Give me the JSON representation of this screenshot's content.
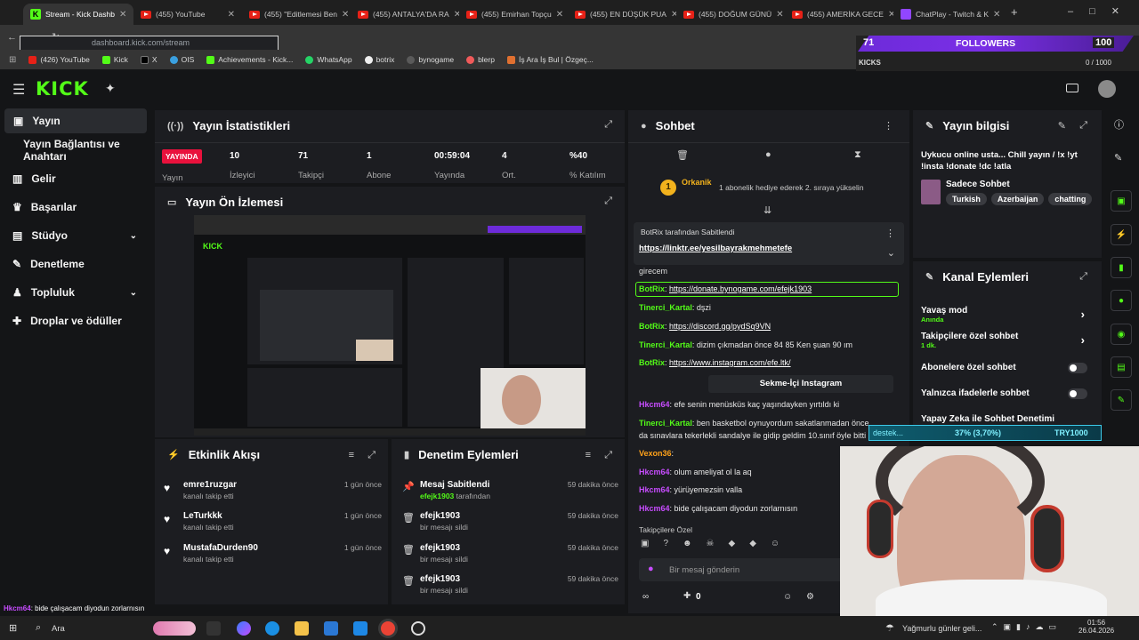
{
  "browser": {
    "tabs": [
      {
        "label": "Stream - Kick Dashb",
        "icon": "kick"
      },
      {
        "label": "(455) YouTube",
        "icon": "youtube"
      },
      {
        "label": "(455) \"Editlemesi Ben",
        "icon": "youtube"
      },
      {
        "label": "(455) ANTALYA'DA RA",
        "icon": "youtube"
      },
      {
        "label": "(455) Emirhan Topçu",
        "icon": "youtube"
      },
      {
        "label": "(455) EN DÜŞÜK PUA",
        "icon": "youtube"
      },
      {
        "label": "(455) DOĞUM GÜNÜ",
        "icon": "youtube"
      },
      {
        "label": "(455) AMERİKA GECE",
        "icon": "youtube"
      },
      {
        "label": "ChatPlay - Twitch & K",
        "icon": "twitch"
      }
    ],
    "url": "dashboard.kick.com/stream",
    "bookmarks": [
      "(426) YouTube",
      "Kick",
      "X",
      "OIS",
      "Achievements - Kick...",
      "WhatsApp",
      "botrix",
      "bynogame",
      "blerp",
      "İş Ara İş Bul | Özgeç..."
    ]
  },
  "overlay": {
    "followers_count": "71",
    "followers_label": "FOLLOWERS",
    "followers_goal": "100",
    "kicks_label": "KICKS",
    "kicks_progress": "0 / 1000",
    "donation_text": "destek...",
    "donation_percent": "37% (3,70%)",
    "donation_goal": "TRY1000"
  },
  "sidebar": {
    "items": [
      {
        "label": "Yayın",
        "icon": "broadcast-icon",
        "selected": true
      },
      {
        "label": "Yayın Bağlantısı ve Anahtarı",
        "icon": "link-icon"
      },
      {
        "label": "Gelir",
        "icon": "chart-icon"
      },
      {
        "label": "Başarılar",
        "icon": "trophy-icon"
      },
      {
        "label": "Stüdyo",
        "icon": "studio-icon",
        "expandable": true
      },
      {
        "label": "Denetleme",
        "icon": "wrench-icon"
      },
      {
        "label": "Topluluk",
        "icon": "community-icon",
        "expandable": true
      },
      {
        "label": "Droplar ve ödüller",
        "icon": "gift-icon"
      }
    ]
  },
  "stats": {
    "title": "Yayın İstatistikleri",
    "live_badge": "YAYINDA",
    "live_label": "Yayın",
    "items": [
      {
        "value": "10",
        "label": "İzleyici"
      },
      {
        "value": "71",
        "label": "Takipçi"
      },
      {
        "value": "1",
        "label": "Abone"
      },
      {
        "value": "00:59:04",
        "label": "Yayında"
      },
      {
        "value": "4",
        "label": "Ort."
      },
      {
        "value": "%40",
        "label": "% Katılım"
      }
    ]
  },
  "preview": {
    "title": "Yayın Ön İzlemesi"
  },
  "activity": {
    "title": "Etkinlik Akışı",
    "rows": [
      {
        "name": "emre1ruzgar",
        "action": "kanalı takip etti",
        "time": "1 gün önce"
      },
      {
        "name": "LeTurkkk",
        "action": "kanalı takip etti",
        "time": "1 gün önce"
      },
      {
        "name": "MustafaDurden90",
        "action": "kanalı takip etti",
        "time": "1 gün önce"
      }
    ]
  },
  "moderation": {
    "title": "Denetim Eylemleri",
    "rows": [
      {
        "name": "Mesaj Sabitlendi",
        "action_user": "efejk1903",
        "action": "tarafından",
        "time": "59 dakika önce"
      },
      {
        "name": "efejk1903",
        "action": "bir mesajı sildi",
        "time": "59 dakika önce"
      },
      {
        "name": "efejk1903",
        "action": "bir mesajı sildi",
        "time": "59 dakika önce"
      },
      {
        "name": "efejk1903",
        "action": "bir mesajı sildi",
        "time": "59 dakika önce"
      }
    ]
  },
  "chat": {
    "title": "Sohbet",
    "gift_user": "Orkanik",
    "gift_level": "1",
    "gift_text": "1 abonelik hediye ederek 2. sıraya yükselin",
    "pinned_by": "BotRix tarafından Sabitlendi",
    "pinned_link": "https://linktr.ee/yesilbayrakmehmetefe",
    "partial_line": "girecem",
    "messages": [
      {
        "user": "BotRix",
        "text": "https://donate.bynogame.com/efejk1903",
        "link": true,
        "color": "#53fc18",
        "highlight": true
      },
      {
        "user": "Tinerci_Kartal",
        "text": "dşzi",
        "color": "#53fc18"
      },
      {
        "user": "BotRix",
        "text": "https://discord.gg/pydSq9VN",
        "link": true,
        "color": "#53fc18"
      },
      {
        "user": "Tinerci_Kartal",
        "text": "dizim çıkmadan önce 84 85 Ken şuan 90 ım",
        "color": "#53fc18"
      },
      {
        "user": "BotRix",
        "text": "https://www.instagram.com/efe.ltk/",
        "link": true,
        "color": "#53fc18"
      },
      {
        "user": "Hkcm64",
        "text": "efe senin menüsküs kaç yaşındayken yırtıldı ki",
        "color": "#c74cff"
      },
      {
        "user": "Tinerci_Kartal",
        "text": "ben basketbol oynuyordum sakatlanmadan önce",
        "color": "#53fc18"
      },
      {
        "user": "",
        "text": "da sınavlara tekerlekli sandalye ile gidip geldim 10.sınıf öyle bitti",
        "color": "#e8e8e8"
      },
      {
        "user": "Vexon36",
        "text": "",
        "color": "#ffa21a"
      },
      {
        "user": "Hkcm64",
        "text": "olum ameliyat ol la aq",
        "color": "#c74cff"
      },
      {
        "user": "Hkcm64",
        "text": "yürüyemezsin valla",
        "color": "#c74cff"
      },
      {
        "user": "Hkcm64",
        "text": "bide çalışacam diyodun zorlarnısın",
        "color": "#c74cff"
      }
    ],
    "instagram_button": "Sekme-İçi Instagram",
    "followers_only": "Takipçilere Özel",
    "input_placeholder": "Bir mesaj gönderin",
    "viewer_count": "0"
  },
  "stream_info": {
    "title": "Yayın bilgisi",
    "stream_title": "Uykucu online usta... Chill yayın / !x !yt !insta !donate !dc !atla",
    "category": "Sadece Sohbet",
    "tags": [
      "Turkish",
      "Azerbaijan",
      "chatting"
    ]
  },
  "channel_actions": {
    "title": "Kanal Eylemleri",
    "rows": [
      {
        "label": "Yavaş mod",
        "sub": "Anında",
        "control": "chevron"
      },
      {
        "label": "Takipçilere özel sohbet",
        "sub": "1 dk.",
        "control": "chevron"
      },
      {
        "label": "Abonelere özel sohbet",
        "sub": "",
        "control": "toggle"
      },
      {
        "label": "Yalnızca ifadelerle sohbet",
        "sub": "",
        "control": "toggle"
      },
      {
        "label": "Yapay Zeka ile Sohbet Denetimi",
        "sub": "",
        "control": "link"
      }
    ]
  },
  "bottom_overlay_chat": {
    "user": "Hkcm64",
    "text": ": bide çalışacam diyodun zorlarnısın"
  },
  "taskbar": {
    "search": "Ara",
    "weather": "Yağmurlu günler geli...",
    "time": "01:56",
    "date": "26.04.2026"
  },
  "colors": {
    "accent": "#53fc18",
    "live": "#e9113c",
    "panel": "#1c1d21"
  }
}
